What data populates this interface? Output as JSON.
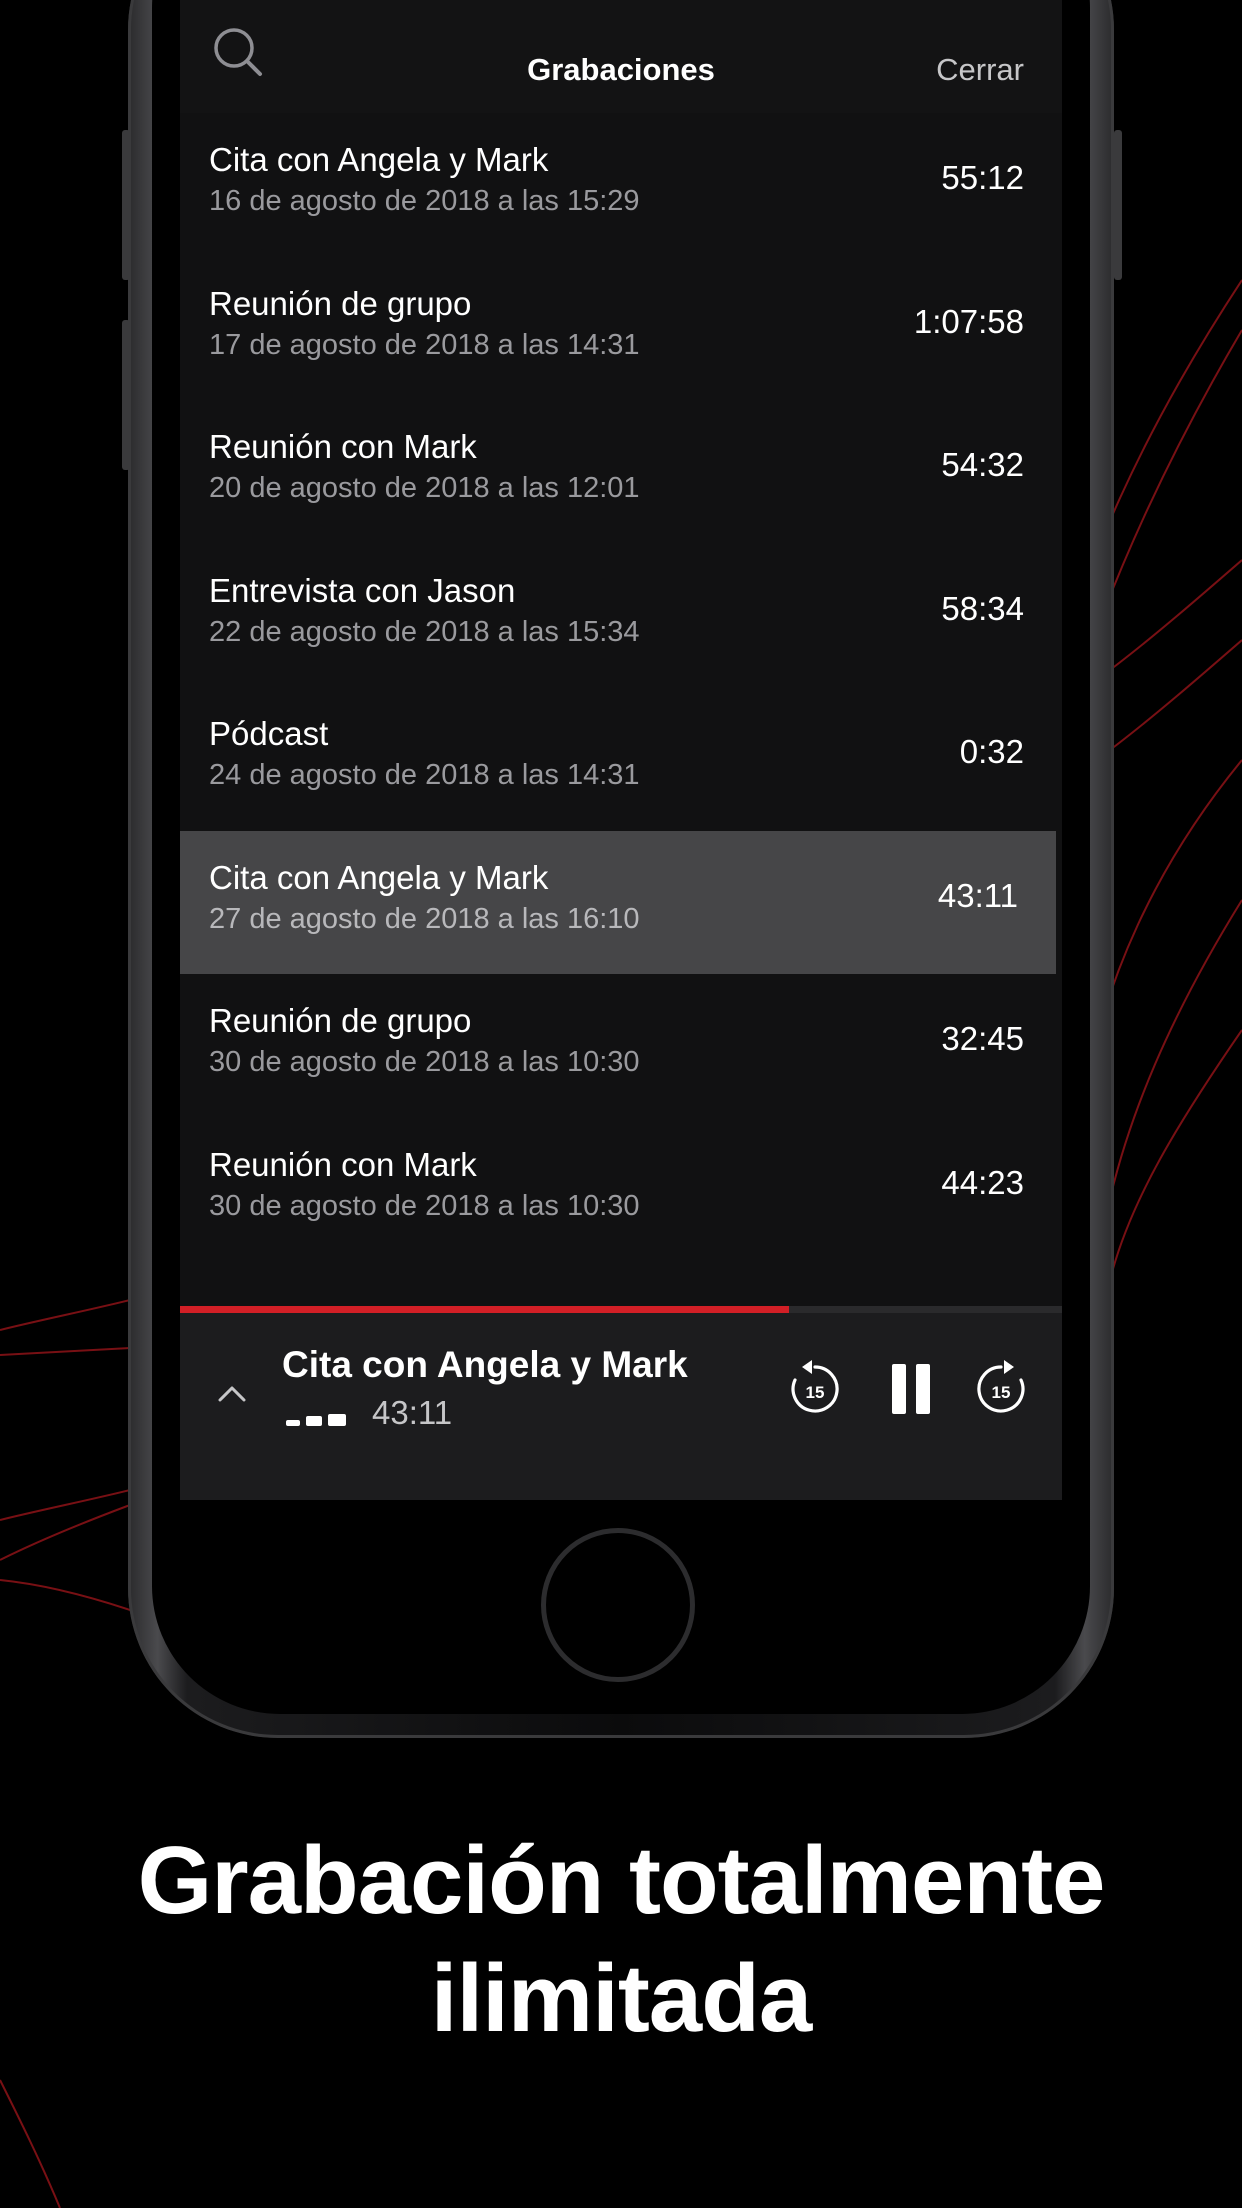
{
  "header": {
    "title": "Grabaciones",
    "close_label": "Cerrar"
  },
  "recordings": [
    {
      "name": "Cita con Angela y Mark",
      "date": "16 de agosto de 2018 a las 15:29",
      "duration": "55:12"
    },
    {
      "name": "Reunión de grupo",
      "date": "17 de agosto de 2018 a las 14:31",
      "duration": "1:07:58"
    },
    {
      "name": "Reunión con Mark",
      "date": "20 de agosto de 2018 a las 12:01",
      "duration": "54:32"
    },
    {
      "name": "Entrevista con Jason",
      "date": "22 de agosto de 2018 a las 15:34",
      "duration": "58:34"
    },
    {
      "name": "Pódcast",
      "date": "24 de agosto de 2018 a las 14:31",
      "duration": "0:32"
    },
    {
      "name": "Cita con Angela y Mark",
      "date": "27 de agosto de 2018 a las 16:10",
      "duration": "43:11",
      "selected": true
    },
    {
      "name": "Reunión de grupo",
      "date": "30 de agosto de 2018 a las 10:30",
      "duration": "32:45"
    },
    {
      "name": "Reunión con Mark",
      "date": "30 de agosto de 2018 a las 10:30",
      "duration": "44:23"
    }
  ],
  "player": {
    "title": "Cita con Angela y Mark",
    "time": "43:11",
    "progress": 0.69,
    "skip_back_seconds": "15",
    "skip_forward_seconds": "15",
    "state": "playing"
  },
  "caption": {
    "line1": "Grabación totalmente",
    "line2": "ilimitada"
  },
  "colors": {
    "accent": "#d21f26",
    "background": "#000000",
    "screen": "#111112",
    "selected_row": "#464648"
  }
}
